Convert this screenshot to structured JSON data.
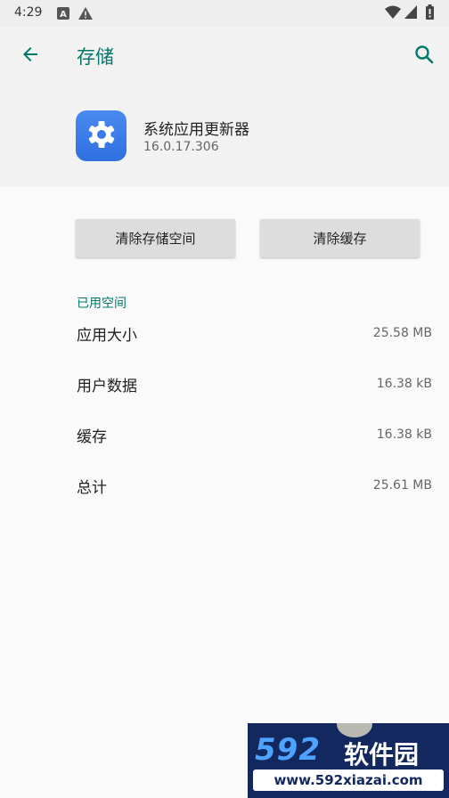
{
  "status_bar": {
    "time": "4:29",
    "icons": [
      "a-notification-icon",
      "warning-icon",
      "wifi-icon",
      "signal-icon",
      "battery-icon"
    ]
  },
  "app_bar": {
    "title": "存储",
    "back_icon": "arrow-left-icon",
    "search_icon": "search-icon"
  },
  "app_info": {
    "icon": "gear-icon",
    "name": "系统应用更新器",
    "version": "16.0.17.306"
  },
  "buttons": {
    "clear_storage": "清除存储空间",
    "clear_cache": "清除缓存"
  },
  "section": {
    "header": "已用空间"
  },
  "storage_rows": [
    {
      "label": "应用大小",
      "value": "25.58 MB"
    },
    {
      "label": "用户数据",
      "value": "16.38 kB"
    },
    {
      "label": "缓存",
      "value": "16.38 kB"
    },
    {
      "label": "总计",
      "value": "25.61 MB"
    }
  ],
  "watermark": {
    "logo_number": "592",
    "logo_text": "软件园",
    "url": "www.592xiazai.com"
  },
  "colors": {
    "accent": "#00796b",
    "app_icon": "#2f6fe0"
  }
}
